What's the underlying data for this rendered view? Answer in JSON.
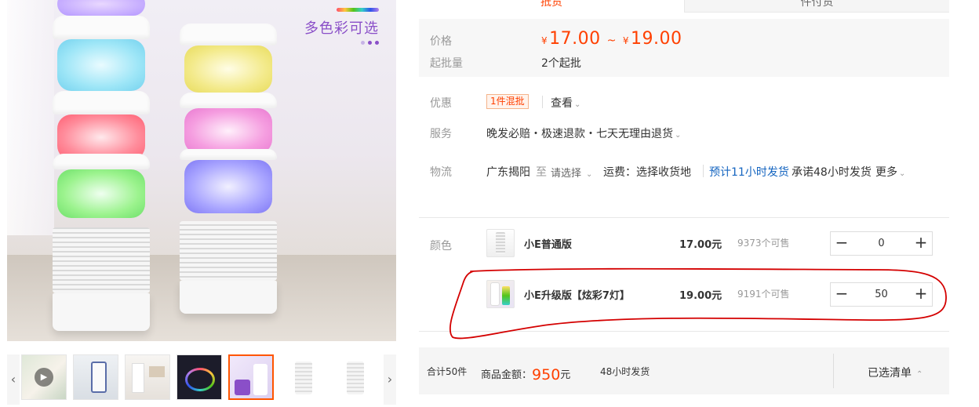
{
  "gallery": {
    "promo_text": "多色彩可选",
    "arrow_prev": "‹",
    "arrow_next": "›",
    "play_symbol": "▶",
    "thumbnail_count": 7,
    "active_thumbnail": 5
  },
  "tabs": {
    "active_label": "抵货",
    "other_label": "件付货"
  },
  "price_box": {
    "price_label": "价格",
    "currency": "¥",
    "price_min": "17.00",
    "separator": "~",
    "price_max": "19.00",
    "moq_label": "起批量",
    "moq_value": "2个起批"
  },
  "promotion": {
    "label": "优惠",
    "tag": "1件混批",
    "more": "查看"
  },
  "service": {
    "label": "服务",
    "text": "晚发必赔・极速退款・七天无理由退货"
  },
  "logistics": {
    "label": "物流",
    "origin": "广东揭阳",
    "to": "至",
    "destination": "请选择",
    "freight": "运费：选择收货地",
    "eta": "预计11小时发货",
    "promise": "承诺48小时发货",
    "more": "更多"
  },
  "sku": {
    "label": "颜色",
    "items": [
      {
        "name": "小E普通版",
        "price": "17.00元",
        "stock": "9373个可售",
        "qty": "0",
        "minus": "−",
        "plus": "+"
      },
      {
        "name": "小E升级版【炫彩7灯】",
        "price": "19.00元",
        "stock": "9191个可售",
        "qty": "50",
        "minus": "−",
        "plus": "+"
      }
    ]
  },
  "footer": {
    "total_count": "合计50件",
    "amount_label": "商品金额：",
    "amount_value": "950",
    "amount_unit": "元",
    "ship": "48小时发货",
    "selected_list": "已选清单"
  },
  "colors": {
    "accent": "#ff4000",
    "annotation": "#d40000",
    "link_blue": "#1565c0"
  }
}
